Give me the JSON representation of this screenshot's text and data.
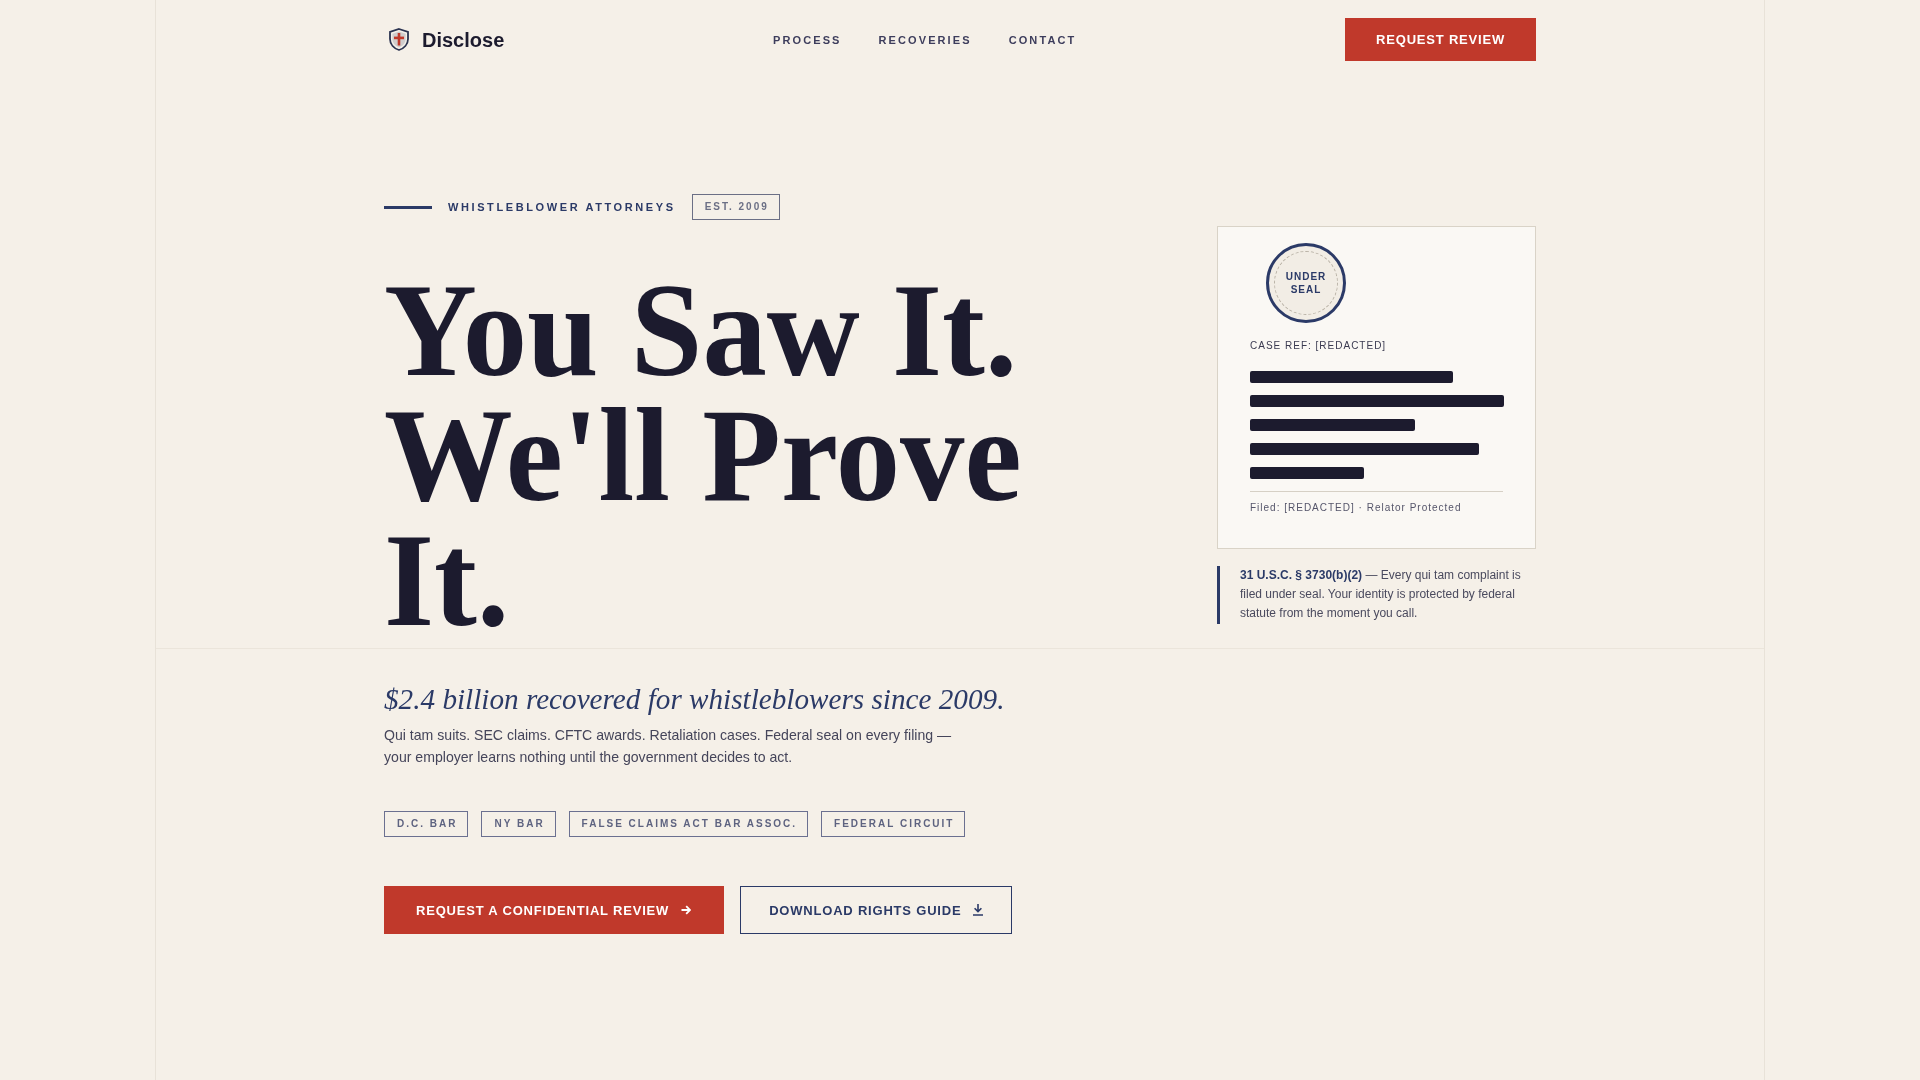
{
  "header": {
    "logo": "Disclose",
    "nav": [
      "PROCESS",
      "RECOVERIES",
      "CONTACT"
    ],
    "cta": "REQUEST REVIEW"
  },
  "hero": {
    "eyebrow": "WHISTLEBLOWER ATTORNEYS",
    "established": "EST. 2009",
    "headline": [
      "You Saw It.",
      "We'll Prove It."
    ],
    "subtitle": "$2.4 billion recovered for whistleblowers since 2009.",
    "description": "Qui tam suits. SEC claims. CFTC awards. Retaliation cases. Federal seal on every filing — your employer learns nothing until the government decides to act.",
    "credentials": [
      "D.C. BAR",
      "NY BAR",
      "FALSE CLAIMS ACT BAR ASSOC.",
      "FEDERAL CIRCUIT"
    ],
    "actions": [
      {
        "label": "REQUEST A CONFIDENTIAL REVIEW",
        "kind": "primary"
      },
      {
        "label": "DOWNLOAD RIGHTS GUIDE",
        "kind": "secondary"
      }
    ]
  },
  "case_card": {
    "seal": "UNDER SEAL",
    "case_ref": "CASE REF: [REDACTED]",
    "filed": "Filed: [REDACTED] · Relator Protected"
  },
  "statute_note": "**31 U.S.C. § 3730(b)(2)** — Every qui tam complaint is filed under seal. Your identity is protected by federal statute from the moment you call."
}
